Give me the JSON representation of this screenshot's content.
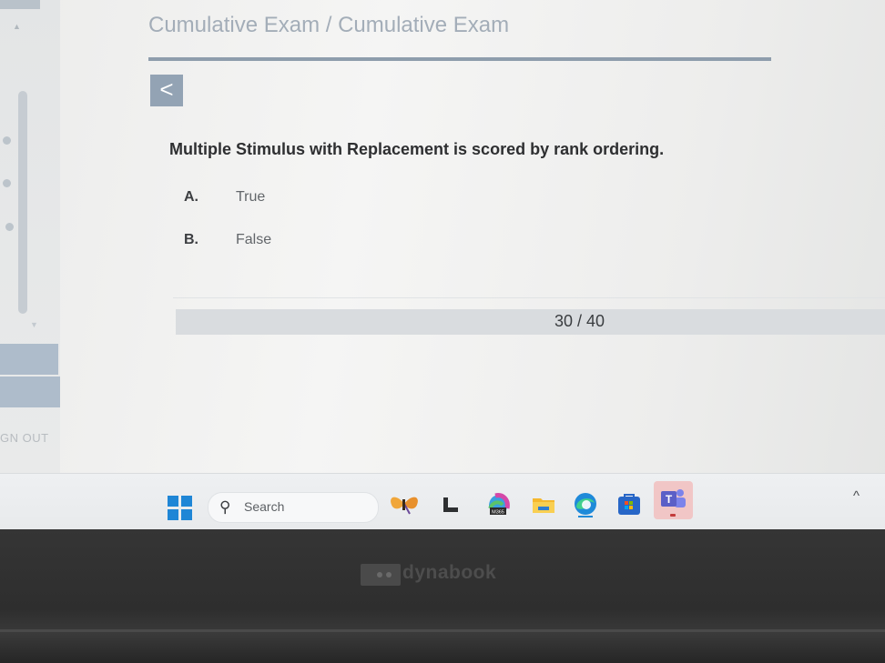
{
  "header": {
    "breadcrumb": "Cumulative Exam / Cumulative Exam",
    "back_glyph": "<"
  },
  "sidebar": {
    "sign_out_label": "GN OUT"
  },
  "question": {
    "text": "Multiple Stimulus with Replacement is scored by rank ordering.",
    "options": [
      {
        "letter": "A.",
        "text": "True"
      },
      {
        "letter": "B.",
        "text": "False"
      }
    ]
  },
  "progress": {
    "label": "30 / 40",
    "current": 30,
    "total": 40
  },
  "taskbar": {
    "search_placeholder": "Search",
    "m365_label": "M365",
    "icons": [
      "windows-start-icon",
      "search-icon",
      "butterfly-widget-icon",
      "snap-app-icon",
      "m365-copilot-icon",
      "file-explorer-icon",
      "edge-browser-icon",
      "microsoft-store-icon",
      "teams-icon",
      "chevron-up-icon"
    ],
    "chevron_glyph": "^"
  },
  "device": {
    "brand": "dynabook"
  },
  "colors": {
    "accent": "#93a3b4",
    "rule": "#8e9dac",
    "windows_blue": "#1f86d6",
    "teams_purple": "#5b5fc7"
  }
}
